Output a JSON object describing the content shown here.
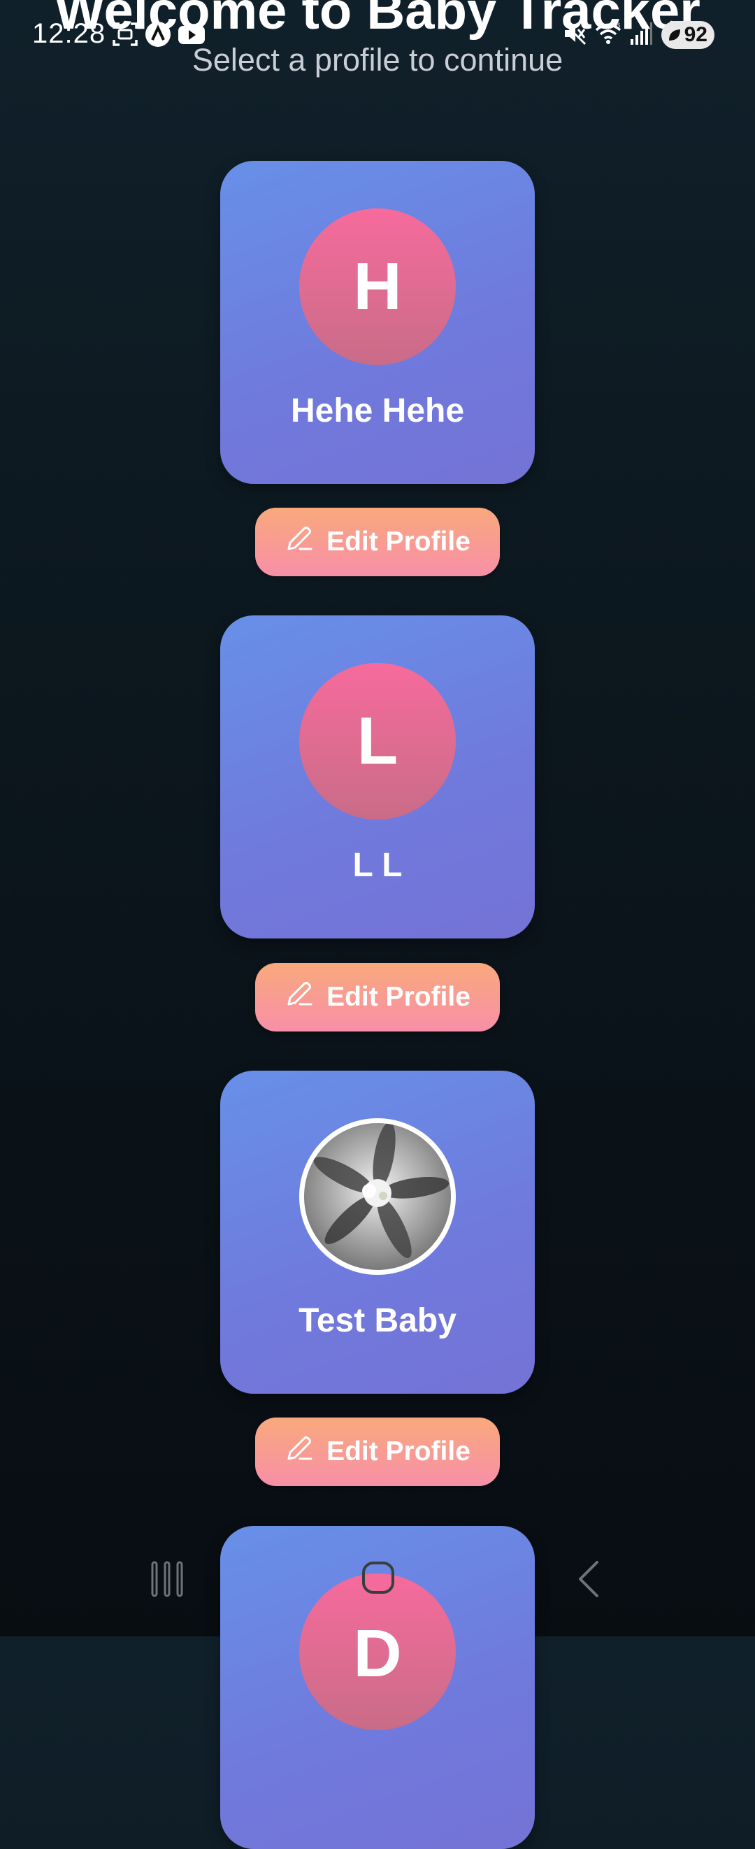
{
  "status_bar": {
    "time": "12:28",
    "battery": "92",
    "icons": [
      "screenshot-icon",
      "app-icon",
      "youtube-icon",
      "mute-icon",
      "wifi-icon",
      "signal-icon",
      "battery-icon"
    ]
  },
  "header": {
    "title": "Welcome to Baby Tracker",
    "subtitle": "Select a profile to continue"
  },
  "profiles": [
    {
      "initial": "H",
      "name": "Hehe Hehe",
      "edit_label": "Edit Profile",
      "has_photo": false
    },
    {
      "initial": "L",
      "name": "L L",
      "edit_label": "Edit Profile",
      "has_photo": false
    },
    {
      "initial": "",
      "name": "Test Baby",
      "edit_label": "Edit Profile",
      "has_photo": true
    },
    {
      "initial": "D",
      "name": "",
      "edit_label": "",
      "has_photo": false
    }
  ],
  "colors": {
    "card_gradient_start": "#6790e8",
    "card_gradient_end": "#7573d6",
    "avatar_gradient_start": "#f66b9c",
    "avatar_gradient_end": "#c96c88",
    "button_gradient_start": "#f9a97c",
    "button_gradient_end": "#f78fa8",
    "background": "#0c171e"
  },
  "nav_bar": {
    "icons": [
      "recent-apps-icon",
      "home-icon",
      "back-icon"
    ]
  }
}
